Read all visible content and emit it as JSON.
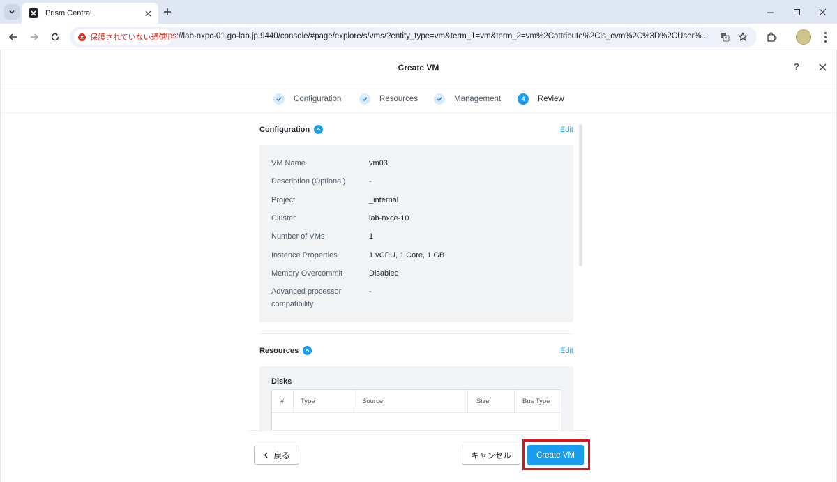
{
  "browser": {
    "tab_title": "Prism Central",
    "security_chip": "保護されていない通信",
    "url_scheme": "https",
    "url_rest": "://lab-nxpc-01.go-lab.jp:9440/console/#page/explore/s/vms/?entity_type=vm&term_1=vm&term_2=vm%2Cattribute%2Cis_cvm%2C%3D%2CUser%..."
  },
  "modal": {
    "title": "Create VM",
    "help_label": "?"
  },
  "stepper": [
    {
      "label": "Configuration",
      "state": "done"
    },
    {
      "label": "Resources",
      "state": "done"
    },
    {
      "label": "Management",
      "state": "done"
    },
    {
      "label": "Review",
      "state": "active",
      "number": "4"
    }
  ],
  "configuration": {
    "title": "Configuration",
    "edit_label": "Edit",
    "rows": [
      {
        "key": "VM Name",
        "value": "vm03"
      },
      {
        "key": "Description (Optional)",
        "value": "-"
      },
      {
        "key": "Project",
        "value": "_internal"
      },
      {
        "key": "Cluster",
        "value": "lab-nxce-10"
      },
      {
        "key": "Number of VMs",
        "value": "1"
      },
      {
        "key": "Instance Properties",
        "value": "1 vCPU, 1 Core, 1 GB"
      },
      {
        "key": "Memory Overcommit",
        "value": "Disabled"
      },
      {
        "key": "Advanced processor compatibility",
        "value": "-"
      }
    ]
  },
  "resources": {
    "title": "Resources",
    "edit_label": "Edit",
    "disks_title": "Disks",
    "disk_columns": [
      "#",
      "Type",
      "Source",
      "Size",
      "Bus Type"
    ]
  },
  "footer": {
    "back_label": "戻る",
    "cancel_label": "キャンセル",
    "create_label": "Create VM"
  },
  "colors": {
    "accent": "#1b9ded",
    "highlight_outline": "#e0121b",
    "insecure": "#d93025"
  }
}
